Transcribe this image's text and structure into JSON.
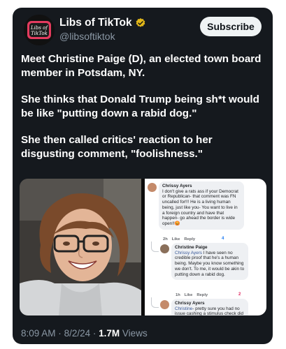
{
  "account": {
    "name": "Libs of TikTok",
    "handle": "@libsoftiktok",
    "avatar_text": "Libs of TikTok",
    "verified": true
  },
  "header": {
    "subscribe_label": "Subscribe"
  },
  "post": {
    "paragraphs": [
      "Meet Christine Paige (D), an elected town board member in Potsdam, NY.",
      "She thinks that Donald Trump being sh*t would be like \"putting down a rabid dog.\"",
      "She then called critics' reaction to her disgusting comment, \"foolishness.\""
    ]
  },
  "screenshot": {
    "comments": [
      {
        "author": "Chrissy Ayers",
        "text": "I don't give a rats ass if your Democrat or Republican- that comment was FN uncalled for!!! He is a living human being, just like you- You want to live in a foreign country and have that happen- go ahead the border is wide open!!😡",
        "time": "2h",
        "like": "Like",
        "reply": "Reply",
        "reaction_count": "4"
      },
      {
        "author": "Christine Paige",
        "text": "I have seen no credible proof that he's a human being. Maybe you know something we don't. To me, it would be akin to putting down a rabid dog.",
        "mention": "Chrissy Ayers",
        "time": "1h",
        "like": "Like",
        "reply": "Reply",
        "reaction_count": "2"
      },
      {
        "author": "Chrissy Ayers",
        "mention": "Christine",
        "text": "- pretty sure you had no issue cashing a stimulus check did you?"
      }
    ]
  },
  "footer": {
    "time": "8:09 AM",
    "sep1": "·",
    "date": "8/2/24",
    "sep2": "·",
    "views_count": "1.7M",
    "views_label": "Views"
  },
  "colors": {
    "card_bg": "#15191e",
    "muted": "#8b98a5",
    "verified_gold": "#e2b719",
    "button_bg": "#eff3f4"
  }
}
